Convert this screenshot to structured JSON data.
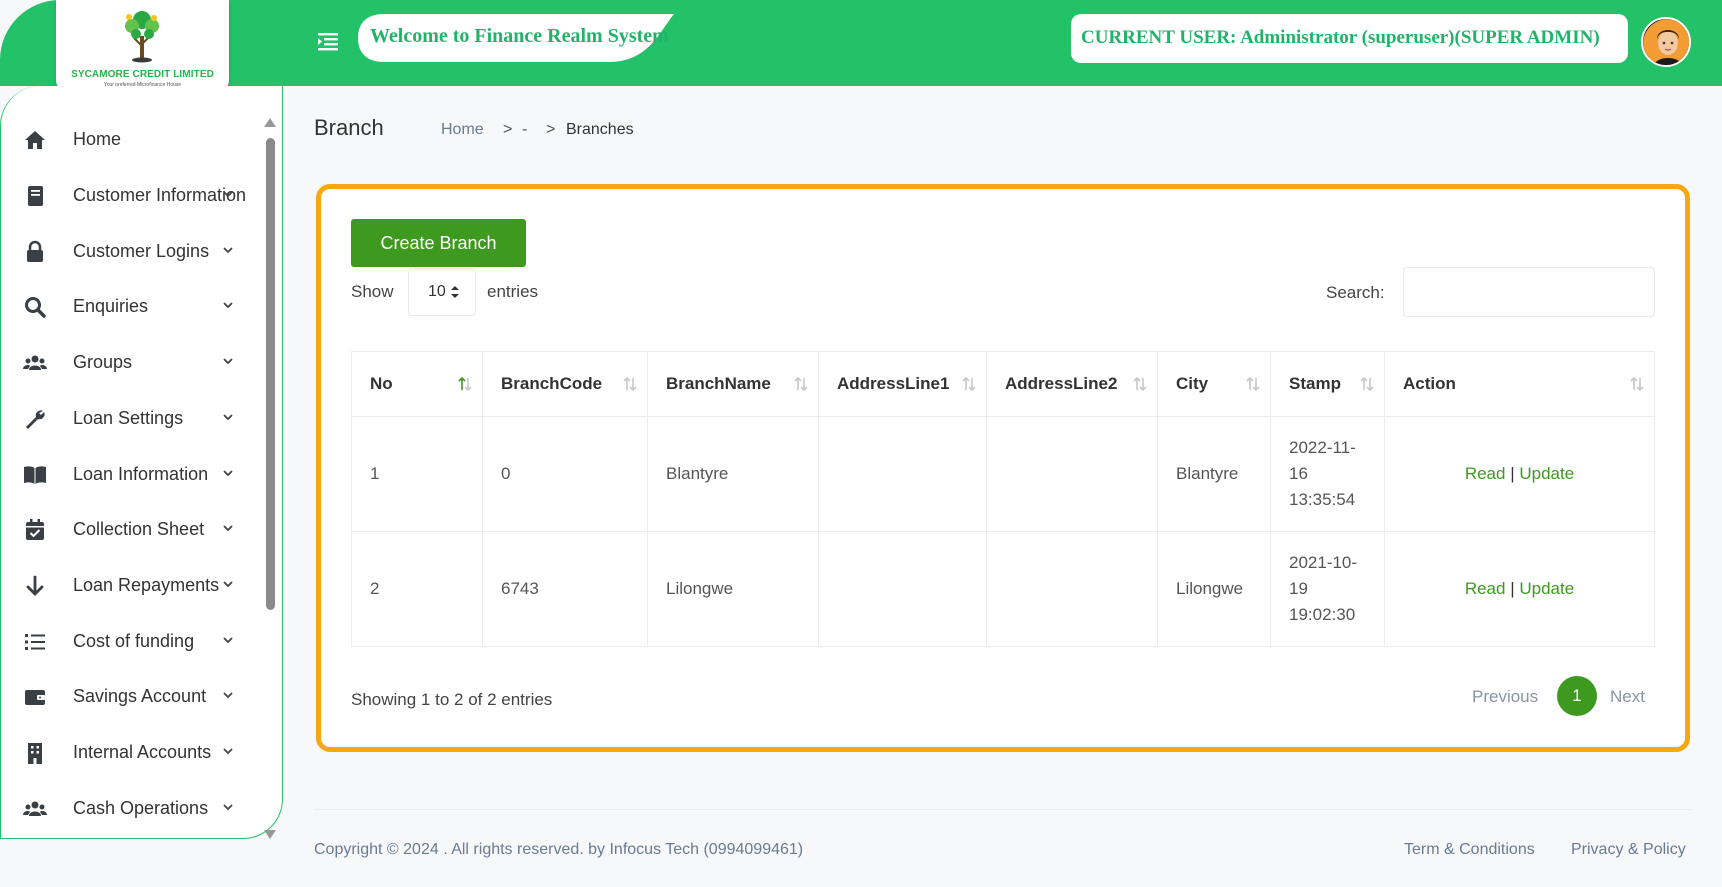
{
  "header": {
    "logo_name": "SYCAMORE CREDIT LIMITED",
    "logo_tagline": "Your preferred Microfinance House",
    "welcome": "Welcome to Finance Realm System",
    "current_user": "CURRENT USER: Administrator (superuser)(SUPER ADMIN)"
  },
  "sidebar": {
    "items": [
      {
        "label": "Home",
        "icon": "home-icon",
        "has_submenu": false
      },
      {
        "label": "Customer Information",
        "icon": "book-icon",
        "has_submenu": true
      },
      {
        "label": "Customer Logins",
        "icon": "lock-icon",
        "has_submenu": true
      },
      {
        "label": "Enquiries",
        "icon": "search-icon",
        "has_submenu": true
      },
      {
        "label": "Groups",
        "icon": "users-icon",
        "has_submenu": true
      },
      {
        "label": "Loan Settings",
        "icon": "wrench-icon",
        "has_submenu": true
      },
      {
        "label": "Loan Information",
        "icon": "open-book-icon",
        "has_submenu": true
      },
      {
        "label": "Collection Sheet",
        "icon": "calendar-check-icon",
        "has_submenu": true
      },
      {
        "label": "Loan Repayments",
        "icon": "arrow-down-icon",
        "has_submenu": true
      },
      {
        "label": "Cost of funding",
        "icon": "list-icon",
        "has_submenu": true
      },
      {
        "label": "Savings Account",
        "icon": "wallet-icon",
        "has_submenu": true
      },
      {
        "label": "Internal Accounts",
        "icon": "building-icon",
        "has_submenu": true
      },
      {
        "label": "Cash Operations",
        "icon": "users-icon",
        "has_submenu": true
      }
    ]
  },
  "page": {
    "title": "Branch",
    "breadcrumb": {
      "home": "Home",
      "middle": "-",
      "current": "Branches",
      "separator": ">"
    }
  },
  "toolbar": {
    "create_label": "Create Branch",
    "show_label": "Show",
    "page_length": "10",
    "entries_label": "entries",
    "search_label": "Search:",
    "search_value": ""
  },
  "table": {
    "columns": [
      "No",
      "BranchCode",
      "BranchName",
      "AddressLine1",
      "AddressLine2",
      "City",
      "Stamp",
      "Action"
    ],
    "rows": [
      {
        "no": "1",
        "code": "0",
        "name": "Blantyre",
        "addr1": "",
        "addr2": "",
        "city": "Blantyre",
        "stamp_l1": "2022-11-",
        "stamp_l2": "16",
        "stamp_l3": "13:35:54",
        "read": "Read",
        "update": "Update"
      },
      {
        "no": "2",
        "code": "6743",
        "name": "Lilongwe",
        "addr1": "",
        "addr2": "",
        "city": "Lilongwe",
        "stamp_l1": "2021-10-",
        "stamp_l2": "19",
        "stamp_l3": "19:02:30",
        "read": "Read",
        "update": "Update"
      }
    ],
    "action_separator": "|"
  },
  "pagination": {
    "info": "Showing 1 to 2 of 2 entries",
    "previous": "Previous",
    "current": "1",
    "next": "Next"
  },
  "footer": {
    "copyright": "Copyright © 2024 . All rights reserved. by Infocus Tech (0994099461)",
    "terms": "Term & Conditions",
    "privacy": "Privacy & Policy"
  },
  "colors": {
    "brand_green": "#23c168",
    "button_green": "#3d9a1f",
    "card_border": "#f7a711"
  }
}
